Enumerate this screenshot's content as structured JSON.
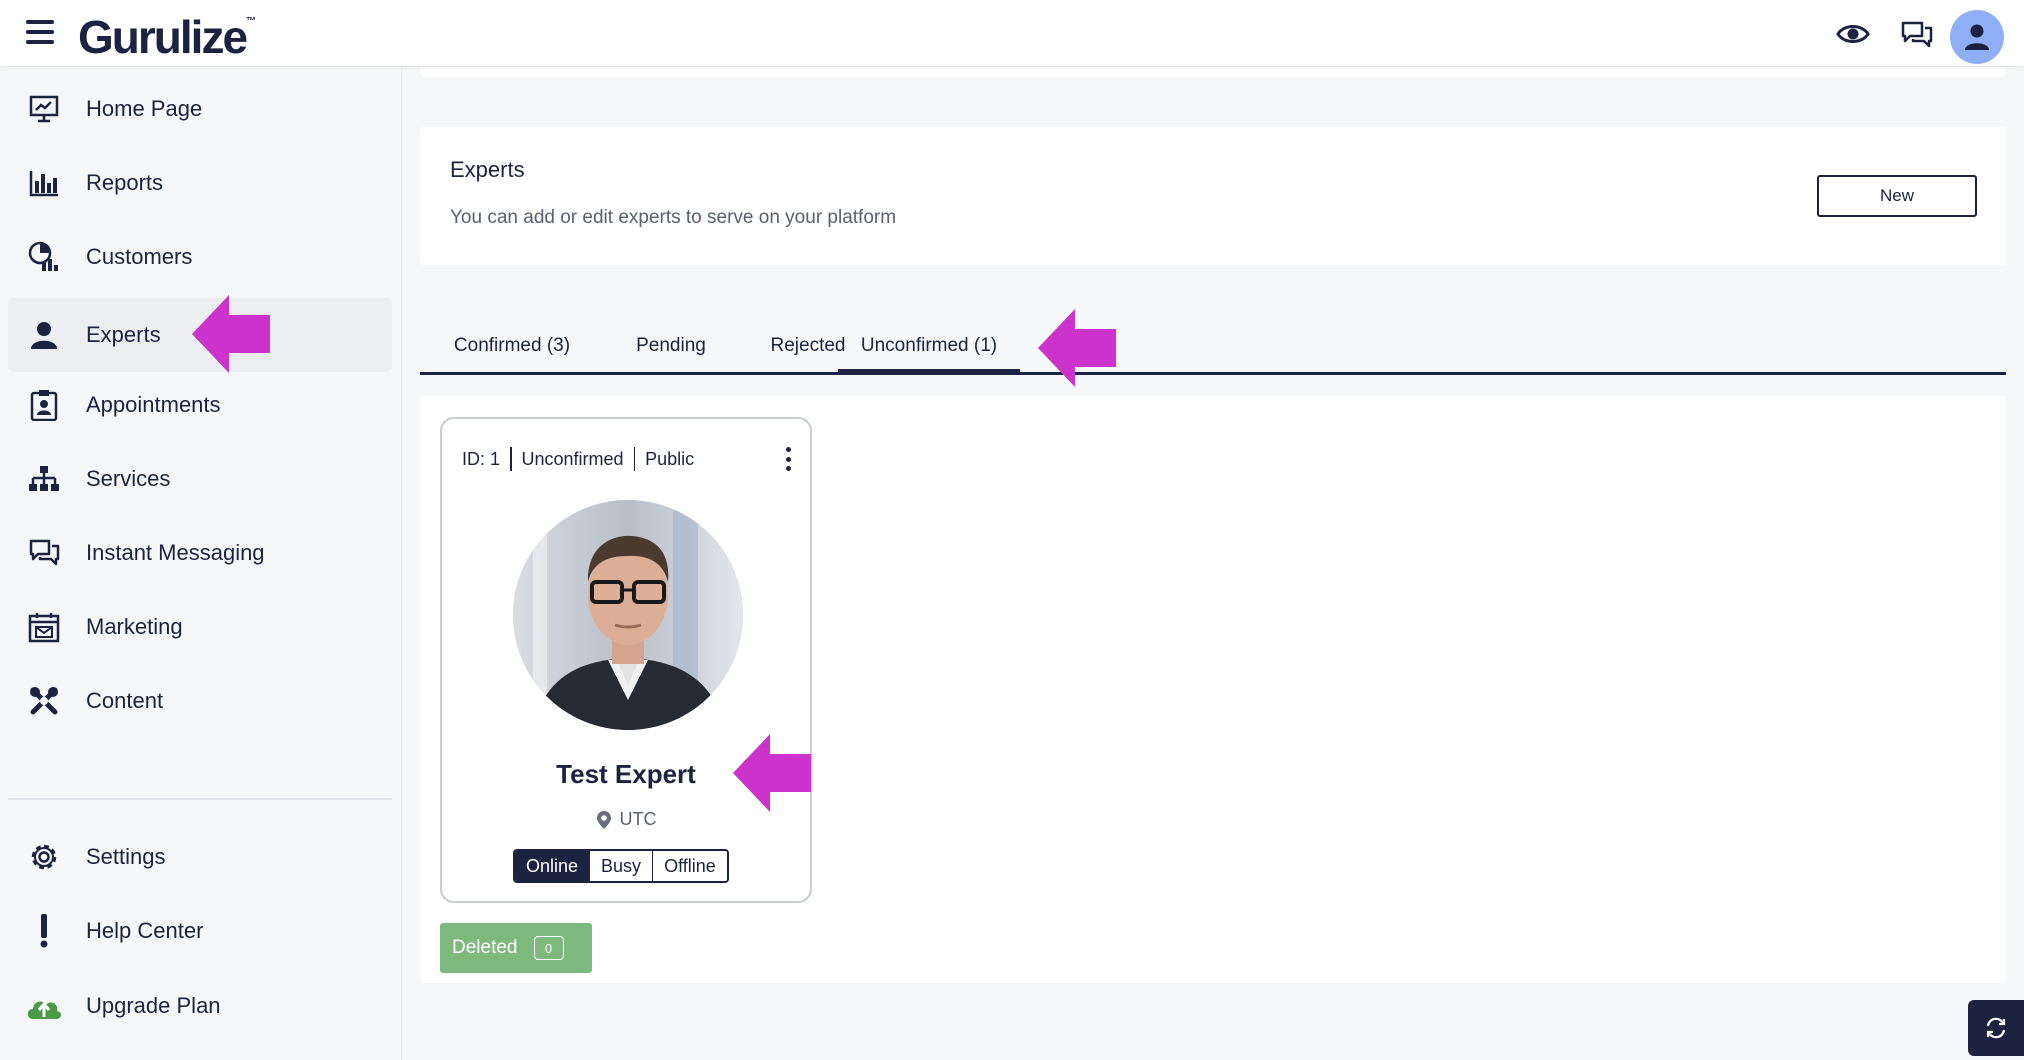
{
  "app": {
    "logo_text": "Gurulize",
    "logo_mark": "™"
  },
  "header": {
    "icons": [
      "menu-icon",
      "eye-icon",
      "chat-icon",
      "user-icon"
    ]
  },
  "sidebar": {
    "items": [
      {
        "label": "Home Page",
        "icon": "monitor-chart-icon"
      },
      {
        "label": "Reports",
        "icon": "bar-chart-icon"
      },
      {
        "label": "Customers",
        "icon": "pie-people-icon"
      },
      {
        "label": "Experts",
        "icon": "person-icon",
        "active": true
      },
      {
        "label": "Appointments",
        "icon": "clipboard-person-icon"
      },
      {
        "label": "Services",
        "icon": "sitemap-icon"
      },
      {
        "label": "Instant Messaging",
        "icon": "chat-bubbles-icon"
      },
      {
        "label": "Marketing",
        "icon": "calendar-mail-icon"
      },
      {
        "label": "Content",
        "icon": "tools-icon"
      }
    ],
    "bottom_items": [
      {
        "label": "Settings",
        "icon": "gear-icon"
      },
      {
        "label": "Help Center",
        "icon": "exclamation-icon"
      },
      {
        "label": "Upgrade Plan",
        "icon": "cloud-upload-icon"
      }
    ]
  },
  "experts_section": {
    "title": "Experts",
    "description": "You can add or edit experts to serve on your platform",
    "new_button": "New"
  },
  "tabs": [
    {
      "label": "Confirmed (3)"
    },
    {
      "label": "Pending"
    },
    {
      "label": "Rejected"
    },
    {
      "label": "Unconfirmed (1)",
      "active": true
    }
  ],
  "expert_card": {
    "id_label": "ID: 1",
    "status": "Unconfirmed",
    "visibility": "Public",
    "name": "Test Expert",
    "timezone": "UTC",
    "availability_options": [
      "Online",
      "Busy",
      "Offline"
    ],
    "selected_availability": "Online"
  },
  "deleted": {
    "label": "Deleted",
    "count": "0"
  },
  "colors": {
    "navy": "#1c2340",
    "annotation_arrow": "#cc33cc",
    "deleted_green": "#7db87c",
    "avatar_bg": "#8eaef5"
  }
}
